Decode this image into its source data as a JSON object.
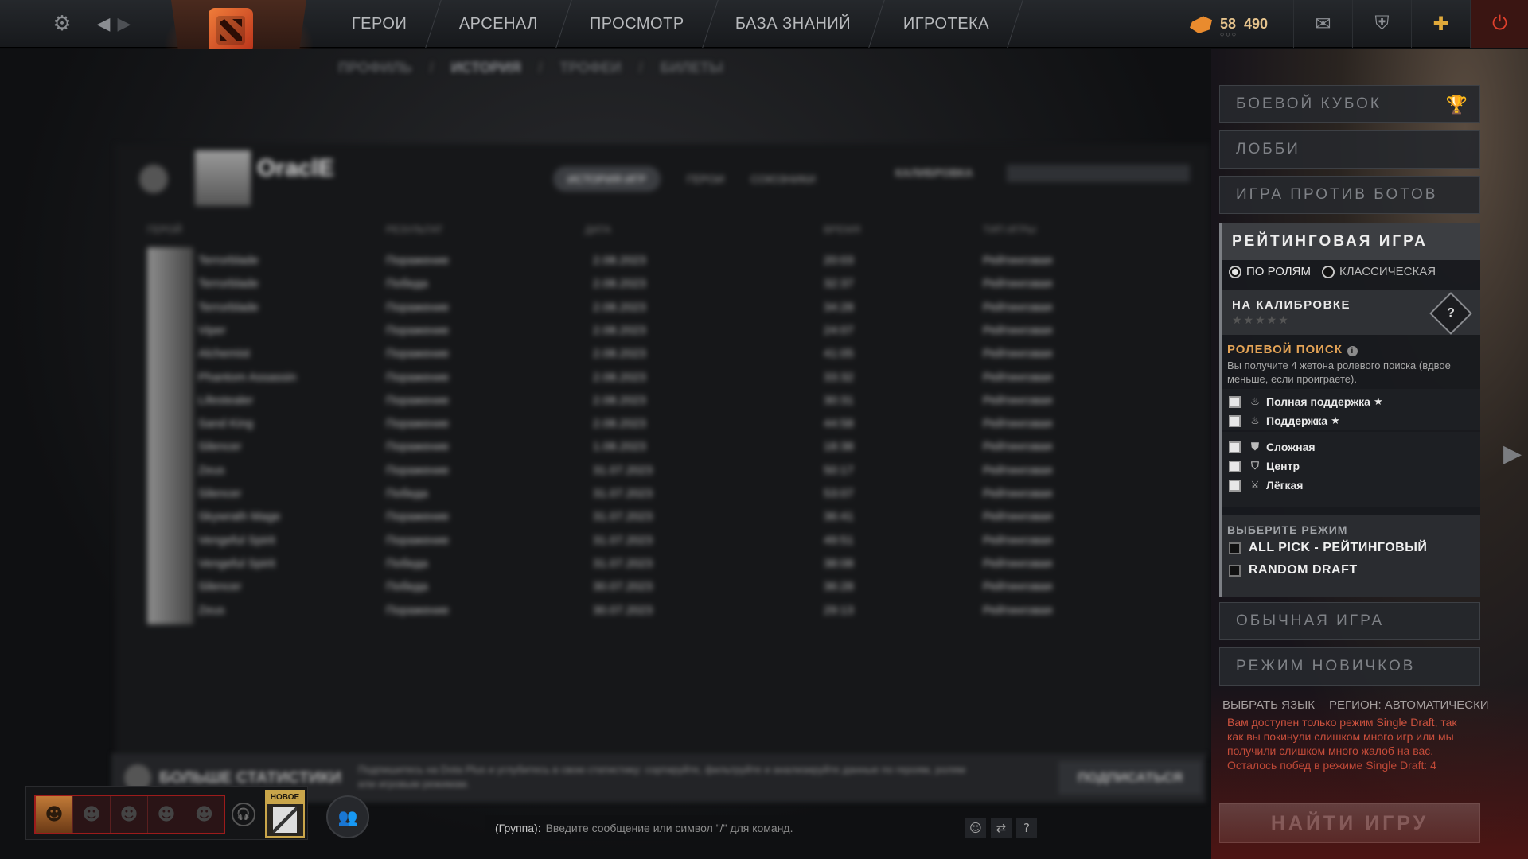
{
  "topbar": {
    "nav": [
      "ГЕРОИ",
      "АРСЕНАЛ",
      "ПРОСМОТР",
      "БАЗА ЗНАНИЙ",
      "ИГРОТЕКА"
    ],
    "currency_a": "58",
    "currency_b": "490",
    "icons": {
      "settings": "gear-icon",
      "back": "arrow-left-icon",
      "forward": "arrow-right-icon",
      "mail": "mail-icon",
      "armory": "shield-icon",
      "plus": "dota-plus-icon",
      "power": "power-icon"
    }
  },
  "subnav": [
    "ПРОФИЛЬ",
    "ИСТОРИЯ",
    "ТРОФЕИ",
    "БИЛЕТЫ"
  ],
  "profile": {
    "name": "OraclE",
    "tabs": [
      "ИСТОРИЯ ИГР",
      "ГЕРОИ",
      "СОЮЗНИКИ"
    ],
    "calibration": "КАЛИБРОВКА",
    "match_headers": [
      "ГЕРОЙ",
      "РЕЗУЛЬТАТ",
      "ДАТА",
      "ВРЕМЯ",
      "ТИП ИГРЫ"
    ],
    "matches": [
      {
        "hero": "Terrorblade",
        "result": "Поражение",
        "date": "2.08.2023",
        "time": "20:03",
        "type": "Рейтинговая"
      },
      {
        "hero": "Terrorblade",
        "result": "Победа",
        "date": "2.08.2023",
        "time": "32:37",
        "type": "Рейтинговая"
      },
      {
        "hero": "Terrorblade",
        "result": "Поражение",
        "date": "2.08.2023",
        "time": "34:28",
        "type": "Рейтинговая"
      },
      {
        "hero": "Viper",
        "result": "Поражение",
        "date": "2.08.2023",
        "time": "24:07",
        "type": "Рейтинговая"
      },
      {
        "hero": "Alchemist",
        "result": "Поражение",
        "date": "2.08.2023",
        "time": "41:05",
        "type": "Рейтинговая"
      },
      {
        "hero": "Phantom Assassin",
        "result": "Поражение",
        "date": "2.08.2023",
        "time": "33:32",
        "type": "Рейтинговая"
      },
      {
        "hero": "Lifestealer",
        "result": "Поражение",
        "date": "2.08.2023",
        "time": "30:31",
        "type": "Рейтинговая"
      },
      {
        "hero": "Sand King",
        "result": "Поражение",
        "date": "2.08.2023",
        "time": "44:58",
        "type": "Рейтинговая"
      },
      {
        "hero": "Silencer",
        "result": "Поражение",
        "date": "1.08.2023",
        "time": "18:38",
        "type": "Рейтинговая"
      },
      {
        "hero": "Zeus",
        "result": "Поражение",
        "date": "31.07.2023",
        "time": "50:17",
        "type": "Рейтинговая"
      },
      {
        "hero": "Silencer",
        "result": "Победа",
        "date": "31.07.2023",
        "time": "53:07",
        "type": "Рейтинговая"
      },
      {
        "hero": "Skywrath Mage",
        "result": "Поражение",
        "date": "31.07.2023",
        "time": "36:41",
        "type": "Рейтинговая"
      },
      {
        "hero": "Vengeful Spirit",
        "result": "Поражение",
        "date": "31.07.2023",
        "time": "49:51",
        "type": "Рейтинговая"
      },
      {
        "hero": "Vengeful Spirit",
        "result": "Победа",
        "date": "31.07.2023",
        "time": "38:08",
        "type": "Рейтинговая"
      },
      {
        "hero": "Silencer",
        "result": "Победа",
        "date": "30.07.2023",
        "time": "36:28",
        "type": "Рейтинговая"
      },
      {
        "hero": "Zeus",
        "result": "Поражение",
        "date": "30.07.2023",
        "time": "29:13",
        "type": "Рейтинговая"
      }
    ],
    "more_stats": "БОЛЬШЕ СТАТИСТИКИ",
    "more_stats_desc": "Подпишитесь на Dota Plus и углубитесь в свою статистику: сортируйте, фильтруйте и анализируйте данные по героям, ролям или игровым режимам.",
    "subscribe": "ПОДПИСАТЬСЯ"
  },
  "play": {
    "battle_cup": "БОЕВОЙ КУБОК",
    "lobby": "ЛОББИ",
    "bots": "ИГРА ПРОТИВ БОТОВ",
    "ranked": {
      "title": "РЕЙТИНГОВАЯ ИГРА",
      "radio_roles": "ПО РОЛЯМ",
      "radio_classic": "КЛАССИЧЕСКАЯ",
      "calibration": "НА КАЛИБРОВКЕ",
      "calibration_stars": "★★★★★",
      "medal": "?",
      "role_search_title": "РОЛЕВОЙ ПОИСК",
      "role_search_desc": "Вы получите 4 жетона ролевого поиска (вдвое меньше, если проиграете).",
      "roles": [
        {
          "label": "Полная поддержка",
          "icon": "hard-support-icon",
          "starred": true
        },
        {
          "label": "Поддержка",
          "icon": "support-icon",
          "starred": true
        },
        {
          "label": "Сложная",
          "icon": "offlane-icon",
          "starred": false
        },
        {
          "label": "Центр",
          "icon": "mid-icon",
          "starred": false
        },
        {
          "label": "Лёгкая",
          "icon": "carry-icon",
          "starred": false
        }
      ],
      "select_mode_title": "ВЫБЕРИТЕ РЕЖИМ",
      "modes": [
        "ALL PICK - РЕЙТИНГОВЫЙ",
        "RANDOM DRAFT"
      ]
    },
    "unranked": "ОБЫЧНАЯ ИГРА",
    "new_player": "РЕЖИМ НОВИЧКОВ",
    "language": "ВЫБРАТЬ ЯЗЫК",
    "region": "РЕГИОН: АВТОМАТИЧЕСКИ",
    "warning": "Вам доступен только режим Single Draft, так как вы покинули слишком много игр или мы получили слишком много жалоб на вас.",
    "warning_wins": "Осталось побед в режиме Single Draft: 4",
    "find_game": "НАЙТИ ИГРУ"
  },
  "bottom": {
    "new_badge": "НОВОЕ",
    "chat_label": "(Группа):",
    "chat_placeholder": "Введите сообщение или символ \"/\" для команд.",
    "help": "?"
  }
}
